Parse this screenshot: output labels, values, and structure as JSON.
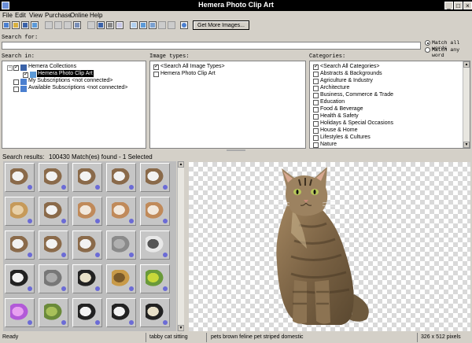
{
  "window": {
    "title": "Hemera Photo Clip Art"
  },
  "menu": [
    "File",
    "Edit",
    "View",
    "Purchase",
    "Online",
    "Help"
  ],
  "toolbar": {
    "get_more_label": "Get More Images..."
  },
  "search": {
    "label": "Search for:",
    "value": "",
    "match_all": "Match all words",
    "match_any": "Match any word",
    "match_all_selected": true
  },
  "search_in": {
    "label": "Search in:",
    "items": [
      {
        "label": "Hemera Collections",
        "checked": true
      },
      {
        "label": "Hemera Photo Clip Art",
        "checked": true,
        "selected": true
      },
      {
        "label": "My Subscriptions <not connected>",
        "checked": false
      },
      {
        "label": "Available Subscriptions <not connected>",
        "checked": false
      }
    ]
  },
  "image_types": {
    "label": "Image types:",
    "items": [
      {
        "label": "<Search All Image Types>",
        "checked": true
      },
      {
        "label": "Hemera Photo Clip Art",
        "checked": false
      }
    ]
  },
  "categories": {
    "label": "Categories:",
    "items": [
      {
        "label": "<Search All Categories>",
        "checked": true
      },
      {
        "label": "Abstracts & Backgrounds",
        "checked": false
      },
      {
        "label": "Agriculture & Industry",
        "checked": false
      },
      {
        "label": "Architecture",
        "checked": false
      },
      {
        "label": "Business, Commerce & Trade",
        "checked": false
      },
      {
        "label": "Education",
        "checked": false
      },
      {
        "label": "Food & Beverage",
        "checked": false
      },
      {
        "label": "Health & Safety",
        "checked": false
      },
      {
        "label": "Holidays & Special Occasions",
        "checked": false
      },
      {
        "label": "House & Home",
        "checked": false
      },
      {
        "label": "Lifestyles & Cultures",
        "checked": false
      },
      {
        "label": "Nature",
        "checked": false
      }
    ]
  },
  "results": {
    "label": "Search results:",
    "count": "100430",
    "summary": "Match(es) found - 1 Selected"
  },
  "thumbnails": [
    [
      "dog-icon",
      "dog-icon",
      "dog-icon",
      "dog-icon",
      "dog-icon"
    ],
    [
      "cat-icon",
      "dog-icon",
      "bulldog-icon",
      "bulldog-icon",
      "bulldog-icon"
    ],
    [
      "dog-icon",
      "dog-icon",
      "dog-icon",
      "rhino-icon",
      "bird-icon"
    ],
    [
      "cow-icon",
      "deer-icon",
      "butterfly-icon",
      "giraffe-icon",
      "frog-icon"
    ],
    [
      "flower-icon",
      "grasshopper-icon",
      "cow-icon",
      "cow-icon",
      "butterfly-icon"
    ]
  ],
  "preview": {
    "subject": "tabby-cat"
  },
  "status": {
    "state": "Ready",
    "title": "tabby cat sitting",
    "keywords": "pets brown feline pet striped domestic",
    "dimensions": "326 x 512 pixels"
  }
}
